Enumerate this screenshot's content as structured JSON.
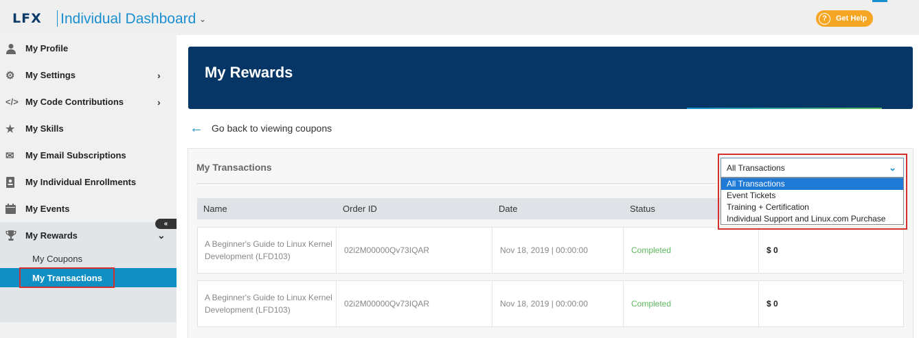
{
  "header": {
    "logo": "LFX",
    "app_title": "Individual Dashboard",
    "help_label": "Get Help",
    "accent": "#1a8fcf"
  },
  "sidebar": {
    "items": [
      {
        "label": "My Profile",
        "icon": "user-icon"
      },
      {
        "label": "My Settings",
        "icon": "gear-icon",
        "has_submenu": true
      },
      {
        "label": "My Code Contributions",
        "icon": "code-icon",
        "has_submenu": true
      },
      {
        "label": "My Skills",
        "icon": "star-icon"
      },
      {
        "label": "My Email Subscriptions",
        "icon": "envelope-icon"
      },
      {
        "label": "My Individual Enrollments",
        "icon": "badge-icon"
      },
      {
        "label": "My Events",
        "icon": "calendar-icon"
      },
      {
        "label": "My Rewards",
        "icon": "trophy-icon",
        "expanded": true
      }
    ],
    "rewards_sub": [
      {
        "label": "My Coupons"
      },
      {
        "label": "My Transactions",
        "active": true
      }
    ],
    "collapse_label": "«"
  },
  "main": {
    "banner_title": "My Rewards",
    "back_label": "Go back to viewing coupons",
    "panel_title": "My Transactions",
    "filter": {
      "selected": "All Transactions",
      "options": [
        "All Transactions",
        "Event Tickets",
        "Training + Certification",
        "Individual Support and Linux.com Purchase"
      ]
    },
    "columns": [
      "Name",
      "Order ID",
      "Date",
      "Status"
    ],
    "rows": [
      {
        "name": "A Beginner's Guide to Linux Kernel Development (LFD103)",
        "order_id": "02i2M00000Qv73IQAR",
        "date": "Nov 18, 2019 | 00:00:00",
        "status": "Completed",
        "amount": "$ 0"
      },
      {
        "name": "A Beginner's Guide to Linux Kernel Development (LFD103)",
        "order_id": "02i2M00000Qv73IQAR",
        "date": "Nov 18, 2019 | 00:00:00",
        "status": "Completed",
        "amount": "$ 0"
      }
    ]
  },
  "colors": {
    "banner": "#053665",
    "active_nav": "#0f8fc4",
    "status_completed": "#5cb85c",
    "help_button": "#f6a623",
    "highlight_border": "#d32f2f"
  }
}
